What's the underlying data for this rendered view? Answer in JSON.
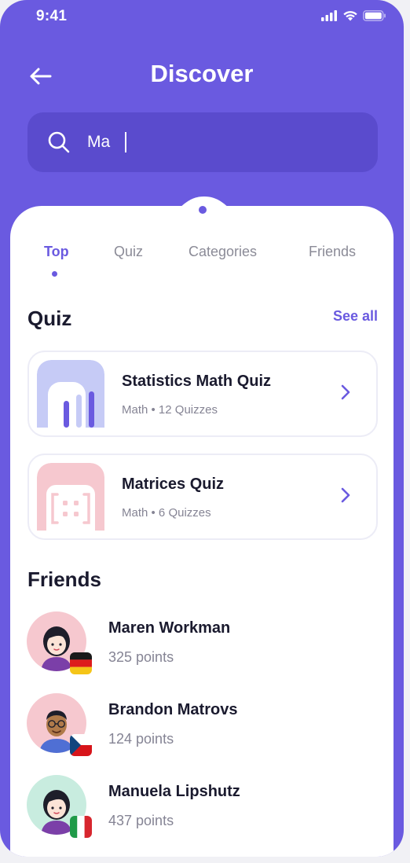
{
  "status": {
    "time": "9:41"
  },
  "header": {
    "title": "Discover"
  },
  "search": {
    "value": "Ma",
    "icon": "search-icon"
  },
  "tabs": [
    {
      "label": "Top",
      "active": true
    },
    {
      "label": "Quiz",
      "active": false
    },
    {
      "label": "Categories",
      "active": false
    },
    {
      "label": "Friends",
      "active": false
    }
  ],
  "quiz_section": {
    "title": "Quiz",
    "see_all": "See all",
    "items": [
      {
        "name": "Statistics Math Quiz",
        "meta": "Math • 12 Quizzes",
        "icon": "bar-chart-icon"
      },
      {
        "name": "Matrices Quiz",
        "meta": "Math • 6 Quizzes",
        "icon": "matrix-icon"
      }
    ]
  },
  "friends_section": {
    "title": "Friends",
    "items": [
      {
        "name": "Maren Workman",
        "points": "325 points",
        "flag": "germany-flag"
      },
      {
        "name": "Brandon Matrovs",
        "points": "124 points",
        "flag": "czech-flag"
      },
      {
        "name": "Manuela Lipshutz",
        "points": "437 points",
        "flag": "italy-flag"
      }
    ]
  },
  "colors": {
    "accent": "#6a5ae0",
    "search_bg": "#5a4bcd",
    "text_dark": "#1a1a2e",
    "text_muted": "#858494"
  }
}
